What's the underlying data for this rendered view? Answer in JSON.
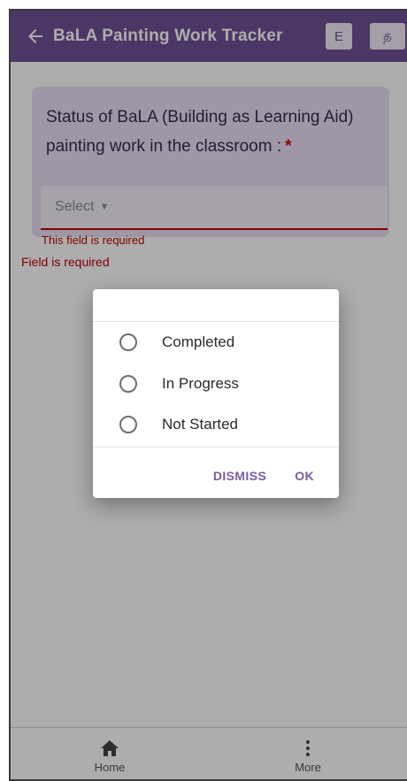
{
  "appbar": {
    "title": "BaLA Painting Work Tracker",
    "lang_english": "E",
    "lang_tamil": "த"
  },
  "form": {
    "question": "Status of BaLA (Building as Learning Aid) painting work in the classroom :",
    "required_mark": "*",
    "select_placeholder": "Select",
    "card_error": "This field is required",
    "field_error": "Field is required"
  },
  "dialog": {
    "options": [
      {
        "label": "Completed",
        "selected": false
      },
      {
        "label": "In Progress",
        "selected": false
      },
      {
        "label": "Not Started",
        "selected": false
      }
    ],
    "dismiss_label": "DISMISS",
    "ok_label": "OK"
  },
  "bottom_nav": {
    "home_label": "Home",
    "more_label": "More"
  },
  "colors": {
    "primary": "#6f5196",
    "card_bg": "#e9dff3",
    "error": "#c00000",
    "dialog_action": "#7a5ba3"
  },
  "icons": {
    "back": "arrow-left-icon",
    "home": "home-icon",
    "more": "more-vertical-icon",
    "caret": "caret-down-icon"
  }
}
